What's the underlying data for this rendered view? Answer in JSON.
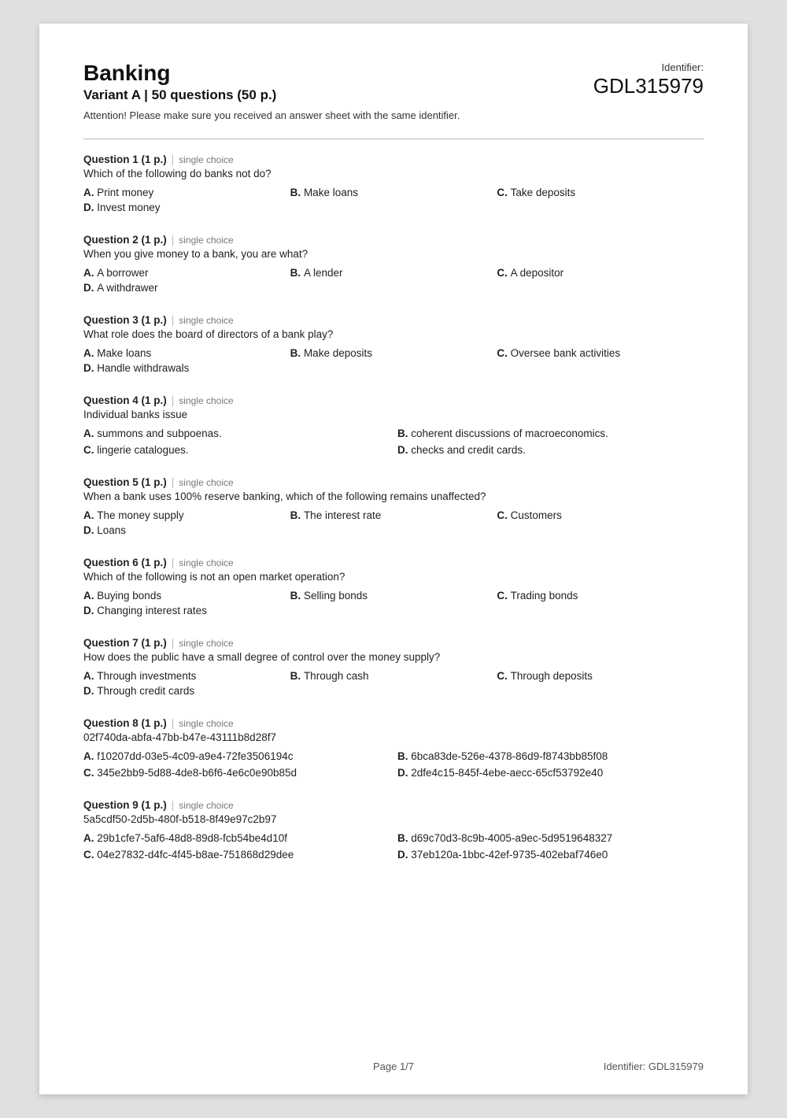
{
  "header": {
    "title": "Banking",
    "subtitle": "Variant A | 50 questions (50 p.)",
    "attention": "Attention! Please make sure you received an answer sheet with the same identifier.",
    "id_label": "Identifier:",
    "id_value": "GDL315979"
  },
  "questions": [
    {
      "label": "Question 1 (1 p.)",
      "type": "single choice",
      "text": "Which of the following do banks not do?",
      "layout": "row",
      "options": [
        {
          "letter": "A.",
          "text": "Print money"
        },
        {
          "letter": "B.",
          "text": "Make loans"
        },
        {
          "letter": "C.",
          "text": "Take deposits"
        },
        {
          "letter": "D.",
          "text": "Invest money"
        }
      ]
    },
    {
      "label": "Question 2 (1 p.)",
      "type": "single choice",
      "text": "When you give money to a bank, you are what?",
      "layout": "row",
      "options": [
        {
          "letter": "A.",
          "text": "A borrower"
        },
        {
          "letter": "B.",
          "text": "A lender"
        },
        {
          "letter": "C.",
          "text": "A depositor"
        },
        {
          "letter": "D.",
          "text": "A withdrawer"
        }
      ]
    },
    {
      "label": "Question 3 (1 p.)",
      "type": "single choice",
      "text": "What role does the board of directors of a bank play?",
      "layout": "row",
      "options": [
        {
          "letter": "A.",
          "text": "Make loans"
        },
        {
          "letter": "B.",
          "text": "Make deposits"
        },
        {
          "letter": "C.",
          "text": "Oversee bank activities"
        },
        {
          "letter": "D.",
          "text": "Handle withdrawals"
        }
      ]
    },
    {
      "label": "Question 4 (1 p.)",
      "type": "single choice",
      "text": "Individual banks issue",
      "layout": "grid2",
      "options": [
        {
          "letter": "A.",
          "text": "summons and subpoenas."
        },
        {
          "letter": "B.",
          "text": "coherent discussions of macroeconomics."
        },
        {
          "letter": "C.",
          "text": "lingerie catalogues."
        },
        {
          "letter": "D.",
          "text": "checks and credit cards."
        }
      ]
    },
    {
      "label": "Question 5 (1 p.)",
      "type": "single choice",
      "text": "When a bank uses 100% reserve banking, which of the following remains unaffected?",
      "layout": "row",
      "options": [
        {
          "letter": "A.",
          "text": "The money supply"
        },
        {
          "letter": "B.",
          "text": "The interest rate"
        },
        {
          "letter": "C.",
          "text": "Customers"
        },
        {
          "letter": "D.",
          "text": "Loans"
        }
      ]
    },
    {
      "label": "Question 6 (1 p.)",
      "type": "single choice",
      "text": "Which of the following is not an open market operation?",
      "layout": "row",
      "options": [
        {
          "letter": "A.",
          "text": "Buying bonds"
        },
        {
          "letter": "B.",
          "text": "Selling bonds"
        },
        {
          "letter": "C.",
          "text": "Trading bonds"
        },
        {
          "letter": "D.",
          "text": "Changing interest rates"
        }
      ]
    },
    {
      "label": "Question 7 (1 p.)",
      "type": "single choice",
      "text": "How does the public have a small degree of control over the money supply?",
      "layout": "row",
      "options": [
        {
          "letter": "A.",
          "text": "Through investments"
        },
        {
          "letter": "B.",
          "text": "Through cash"
        },
        {
          "letter": "C.",
          "text": "Through deposits"
        },
        {
          "letter": "D.",
          "text": "Through credit cards"
        }
      ]
    },
    {
      "label": "Question 8 (1 p.)",
      "type": "single choice",
      "text": "02f740da-abfa-47bb-b47e-43111b8d28f7",
      "layout": "grid2",
      "options": [
        {
          "letter": "A.",
          "text": "f10207dd-03e5-4c09-a9e4-72fe3506194c"
        },
        {
          "letter": "B.",
          "text": "6bca83de-526e-4378-86d9-f8743bb85f08"
        },
        {
          "letter": "C.",
          "text": "345e2bb9-5d88-4de8-b6f6-4e6c0e90b85d"
        },
        {
          "letter": "D.",
          "text": "2dfe4c15-845f-4ebe-aecc-65cf53792e40"
        }
      ]
    },
    {
      "label": "Question 9 (1 p.)",
      "type": "single choice",
      "text": "5a5cdf50-2d5b-480f-b518-8f49e97c2b97",
      "layout": "grid2",
      "options": [
        {
          "letter": "A.",
          "text": "29b1cfe7-5af6-48d8-89d8-fcb54be4d10f"
        },
        {
          "letter": "B.",
          "text": "d69c70d3-8c9b-4005-a9ec-5d9519648327"
        },
        {
          "letter": "C.",
          "text": "04e27832-d4fc-4f45-b8ae-751868d29dee"
        },
        {
          "letter": "D.",
          "text": "37eb120a-1bbc-42ef-9735-402ebaf746e0"
        }
      ]
    }
  ],
  "footer": {
    "page": "Page 1/7",
    "id": "Identifier: GDL315979"
  }
}
